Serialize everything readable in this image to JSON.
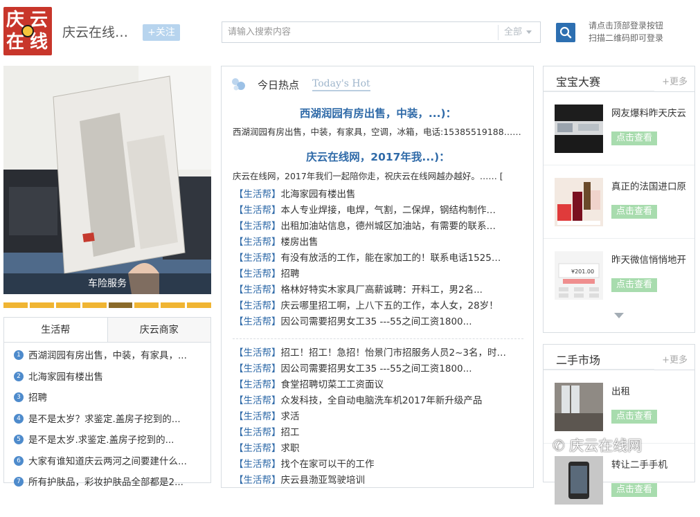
{
  "header": {
    "logo_text": "庆云在线",
    "site_name": "庆云在线…",
    "follow_label": "+关注",
    "search": {
      "placeholder": "请输入搜索内容",
      "scope": "全部"
    },
    "login_hint_line1": "请点击顶部登录按钮",
    "login_hint_line2": "扫描二维码即可登录"
  },
  "left": {
    "hero_caption": "车险服务",
    "hero_dots": 8,
    "hero_active_dot": 4,
    "tabs": [
      "生活帮",
      "庆云商家"
    ],
    "items": [
      {
        "num": "1",
        "text": "西湖润园有房出售，中装，有家具，..."
      },
      {
        "num": "2",
        "text": "北海家园有楼出售"
      },
      {
        "num": "3",
        "text": "招聘"
      },
      {
        "num": "4",
        "text": "是不是太岁？求鉴定.盖房子挖到的..."
      },
      {
        "num": "5",
        "text": "是不是太岁.求鉴定.盖房子挖到的..."
      },
      {
        "num": "6",
        "text": "大家有谁知道庆云两河之间要建什么..."
      },
      {
        "num": "7",
        "text": "所有护肤品，彩妆护肤品全部都是2..."
      }
    ]
  },
  "middle": {
    "hot_title": "今日热点",
    "hot_sub": "Today's Hot",
    "featured": [
      {
        "title": "西湖润园有房出售，中装，...)：",
        "desc": "西湖润园有房出售，中装，有家具，空调，冰箱，电话:15385519188……"
      },
      {
        "title": "庆云在线网，2017年我...)：",
        "desc": "庆云在线网，2017年我们一起陪你走，祝庆云在线网越办越好。…… ["
      }
    ],
    "tag": "【生活帮】",
    "news1": [
      "北海家园有楼出售",
      "本人专业焊接，电焊，气割，二保焊，钢结构制作…",
      "出租加油站信息，德州城区加油站，有需要的联系…",
      "楼房出售",
      "有没有放活的工作，能在家加工的！联系电话1525…",
      "招聘",
      "格林好特实木家具厂高薪诚聘：开料工，男2名...",
      "庆云哪里招工啊，上八下五的工作，本人女，28岁！",
      "因公司需要招男女工35 ---55之间工资1800..."
    ],
    "news2": [
      "招工！招工！急招！怡景门市招服务人员2~3名，时…",
      "因公司需要招男女工35 ---55之间工资1800...",
      "食堂招聘切菜工工资面议",
      "众发科技，全自动电脑洗车机2017年新升级产品",
      "求活",
      "招工",
      "求职",
      "找个在家可以干的工作",
      "庆云县渤亚驾驶培训"
    ]
  },
  "right": {
    "baby": {
      "title": "宝宝大赛",
      "more": "+更多",
      "cards": [
        {
          "title": "网友爆料昨天庆云",
          "btn": "点击查看"
        },
        {
          "title": "真正的法国进口原",
          "btn": "点击查看"
        },
        {
          "title": "昨天微信悄悄地开",
          "btn": "点击查看",
          "thumb_amount": "¥201.00"
        }
      ]
    },
    "market": {
      "title": "二手市场",
      "more": "+更多",
      "cards": [
        {
          "title": "出租",
          "btn": "点击查看"
        },
        {
          "title": "转让二手手机",
          "btn": "点击查看"
        }
      ]
    },
    "watermark": "庆云在线网"
  },
  "colors": {
    "accent_blue": "#2f6aa8",
    "button_green": "#a8dcae",
    "dot_gold": "#f0b533",
    "logo_red": "#c8362b"
  }
}
